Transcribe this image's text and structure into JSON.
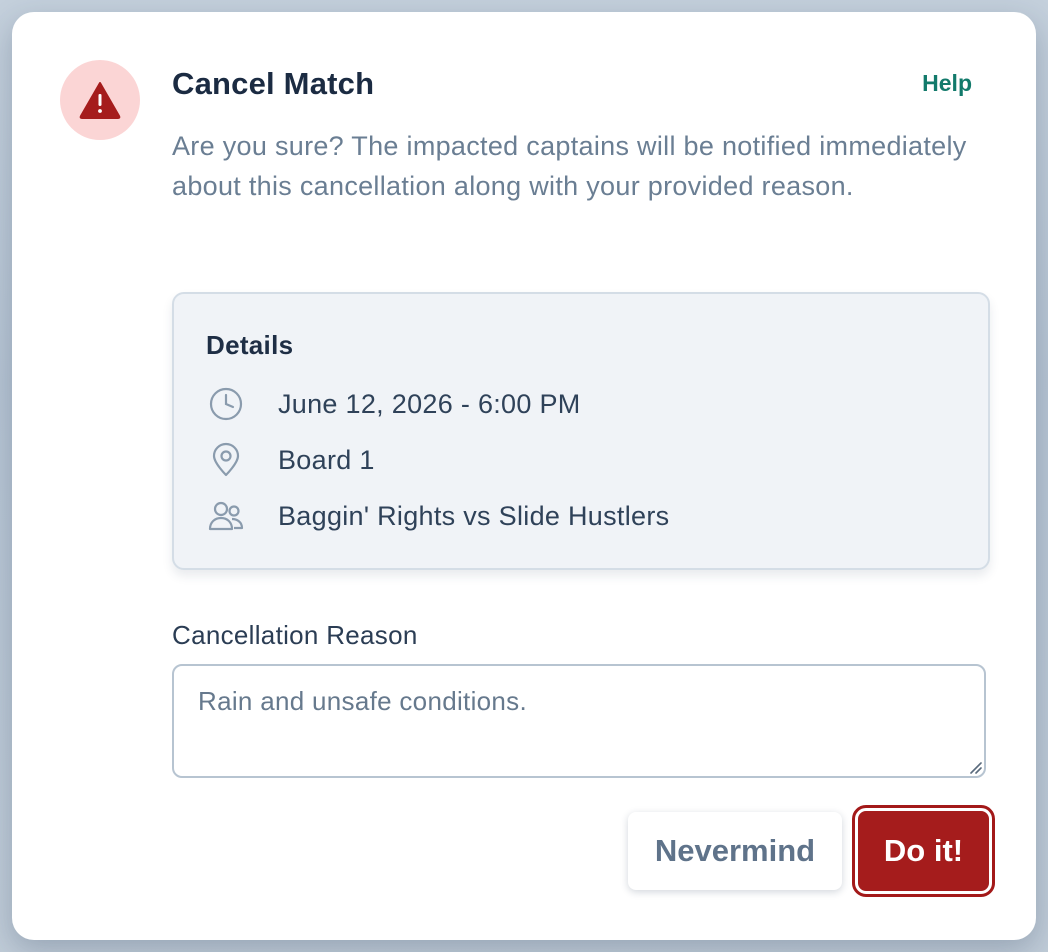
{
  "dialog": {
    "title": "Cancel Match",
    "help_label": "Help",
    "description": "Are you sure? The impacted captains will be notified immediately about this cancellation along with your provided reason."
  },
  "details": {
    "heading": "Details",
    "items": [
      {
        "icon": "clock-icon",
        "text": "June 12, 2026 - 6:00 PM"
      },
      {
        "icon": "location-pin-icon",
        "text": "Board 1"
      },
      {
        "icon": "users-icon",
        "text": "Baggin' Rights vs Slide Hustlers"
      }
    ]
  },
  "reason": {
    "label": "Cancellation Reason",
    "value": "Rain and unsafe conditions."
  },
  "actions": {
    "cancel_label": "Nevermind",
    "confirm_label": "Do it!"
  },
  "colors": {
    "danger": "#a51c1c",
    "danger_soft": "#fbd5d5",
    "link": "#127a6b",
    "title": "#1b2b42",
    "muted": "#6a7e93"
  }
}
